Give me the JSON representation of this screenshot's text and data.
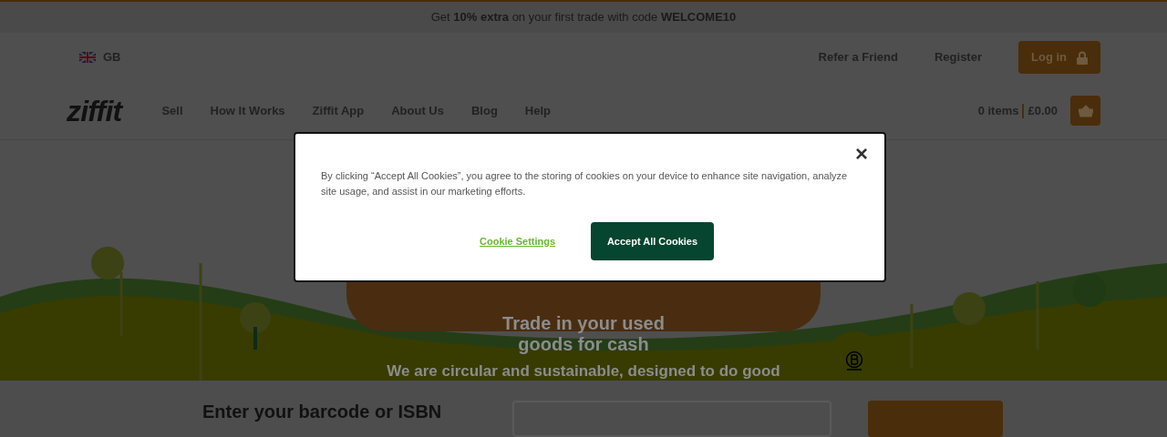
{
  "promo_bar": {
    "text": "Get **10% extra** on your first trade with code **WELCOME10**"
  },
  "top_bar": {
    "country": "GB",
    "links": [
      "Refer a Friend",
      "Register"
    ],
    "login": "Log in"
  },
  "nav": {
    "logo": "ziffit",
    "items": [
      "Sell",
      "How It Works",
      "Ziffit App",
      "About Us",
      "Blog",
      "Help"
    ],
    "basket_count": "0 items",
    "basket_total": "£0.00"
  },
  "hero": {
    "subtitle": "Trade in your used goods for cash",
    "tagline": "We are circular and sustainable, designed to do good"
  },
  "search": {
    "heading": "Enter your barcode or ISBN"
  },
  "cookie_dialog": {
    "text": "By clicking “Accept All Cookies”, you agree to the storing of cookies on your device to enhance site navigation, analyze site usage, and assist in our marketing efforts.",
    "settings_link": "Cookie Settings",
    "accept_button": "Accept All Cookies",
    "close": "×"
  }
}
